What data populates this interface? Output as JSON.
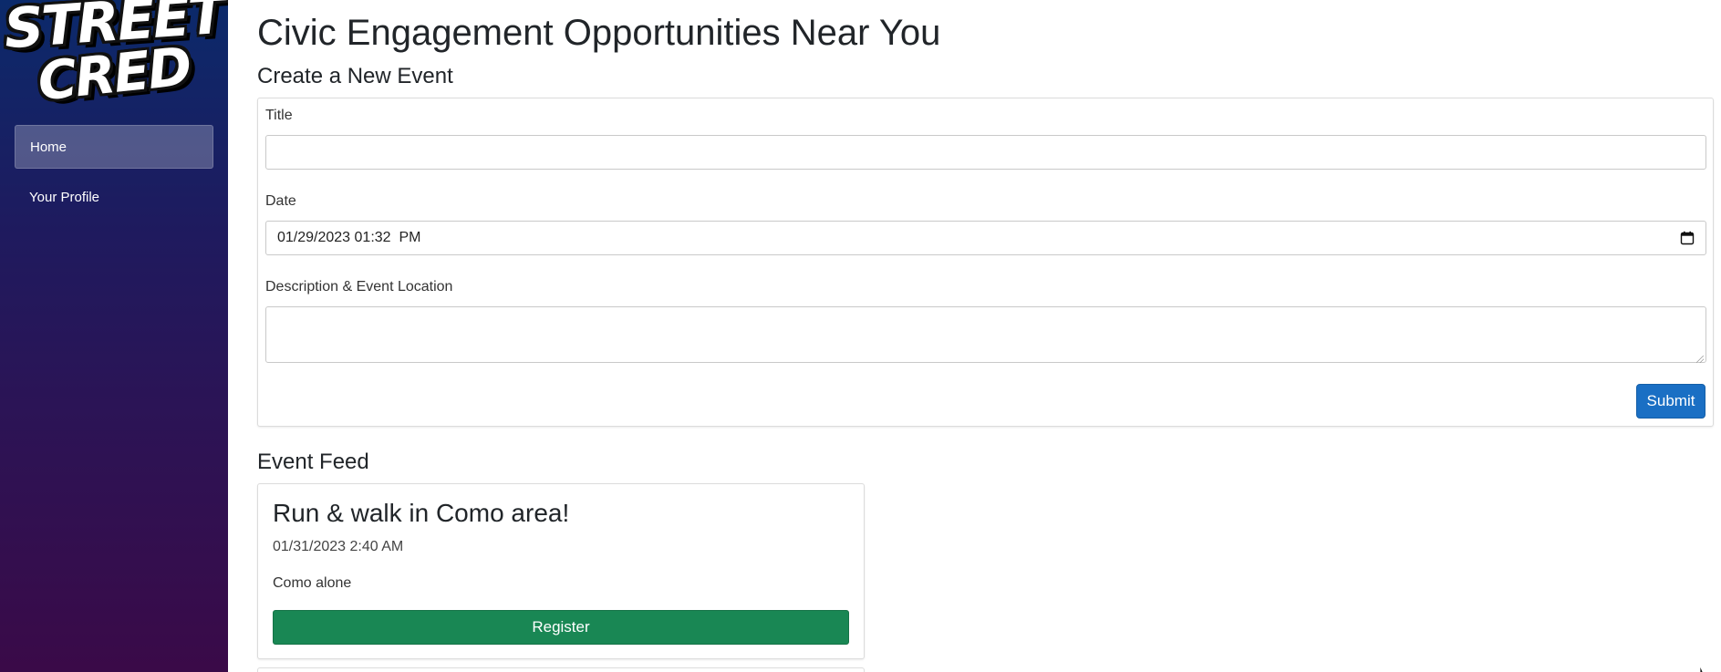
{
  "brand": {
    "logo_line1": "STREET",
    "logo_line2": "CRED"
  },
  "sidebar": {
    "items": [
      {
        "label": "Home",
        "active": true
      },
      {
        "label": "Your Profile",
        "active": false
      }
    ]
  },
  "page": {
    "title": "Civic Engagement Opportunities Near You"
  },
  "create_event": {
    "heading": "Create a New Event",
    "title_label": "Title",
    "title_value": "",
    "date_label": "Date",
    "date_value": "01/29/2023 01:32  PM",
    "description_label": "Description & Event Location",
    "description_value": "",
    "submit_label": "Submit"
  },
  "feed": {
    "heading": "Event Feed",
    "events": [
      {
        "title": "Run & walk in Como area!",
        "datetime": "01/31/2023 2:40 AM",
        "description": "Como alone",
        "register_label": "Register"
      }
    ]
  },
  "colors": {
    "primary": "#1a6fc4",
    "success": "#198754",
    "sidebar_top": "#0b2a6b",
    "sidebar_bottom": "#3a0a48"
  },
  "icons": {
    "date_picker": "calendar-icon"
  }
}
